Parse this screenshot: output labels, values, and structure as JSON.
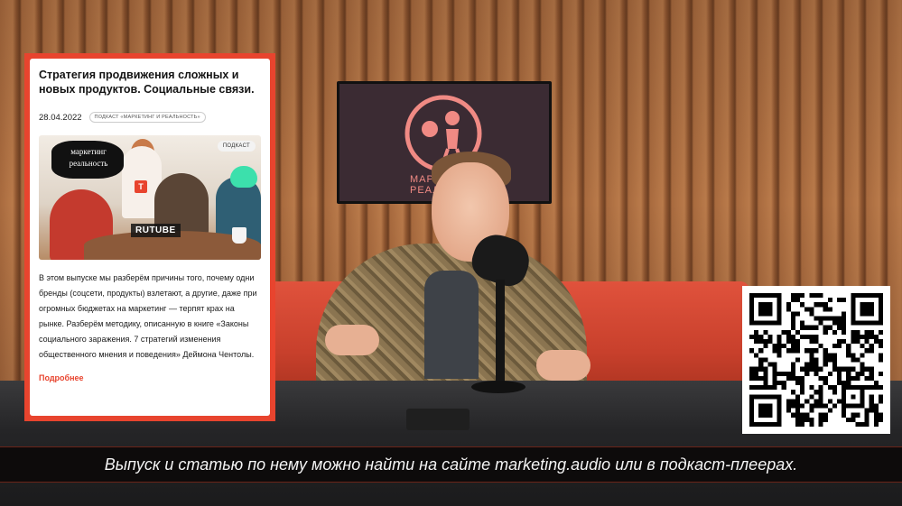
{
  "tv": {
    "caption_line1": "МАРКЕТ",
    "caption_line2": "РЕАЛЬ"
  },
  "card": {
    "title": "Стратегия продвижения сложных и новых продуктов. Социальные связи.",
    "date": "28.04.2022",
    "tag": "Подкаст «Маркетинг и реальность»",
    "media": {
      "logo_line1": "маркетинг",
      "logo_line2": "реальность",
      "badge": "Подкаст",
      "watermark": "RUTUBE",
      "t_mark": "T"
    },
    "body": "В этом выпуске мы разберём причины того, почему одни бренды (соцсети, продукты) взлетают, а другие, даже при огромных бюджетах на маркетинг — терпят крах на рынке. Разберём методику, описанную в книге «Законы социального заражения. 7 стратегий изменения общественного мнения и поведения» Деймона Чентолы.",
    "more_link": "Подробнее"
  },
  "subtitle": "Выпуск и статью по нему можно найти на сайте marketing.audio или в подкаст-плеерах.",
  "colors": {
    "accent": "#e8442e",
    "couch": "#d24a35",
    "subtitle_bg": "#0c0a0a"
  }
}
